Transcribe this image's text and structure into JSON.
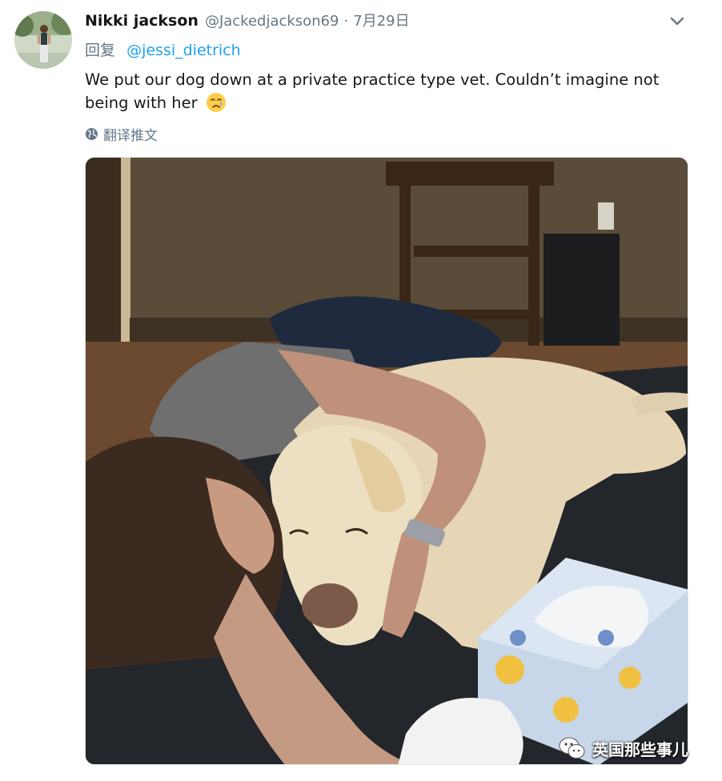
{
  "tweet": {
    "author_name": "Nikki jackson",
    "author_handle": "@Jackedjackson69",
    "separator": "·",
    "date": "7月29日",
    "reply_prefix": "回复",
    "reply_to": "@jessi_dietrich",
    "text": "We put our dog down at a private practice type vet. Couldn’t imagine not being with her",
    "emoji": "crying-face",
    "translate_label": "翻译推文",
    "translate_icon": "globe-icon",
    "menu_icon": "chevron-down-icon"
  },
  "watermark": {
    "text": "英国那些事儿",
    "icon": "wechat-icon"
  },
  "colors": {
    "link": "#1da1f2",
    "secondary_text": "#657786",
    "primary_text": "#14171a",
    "border": "#e1e8ed"
  }
}
